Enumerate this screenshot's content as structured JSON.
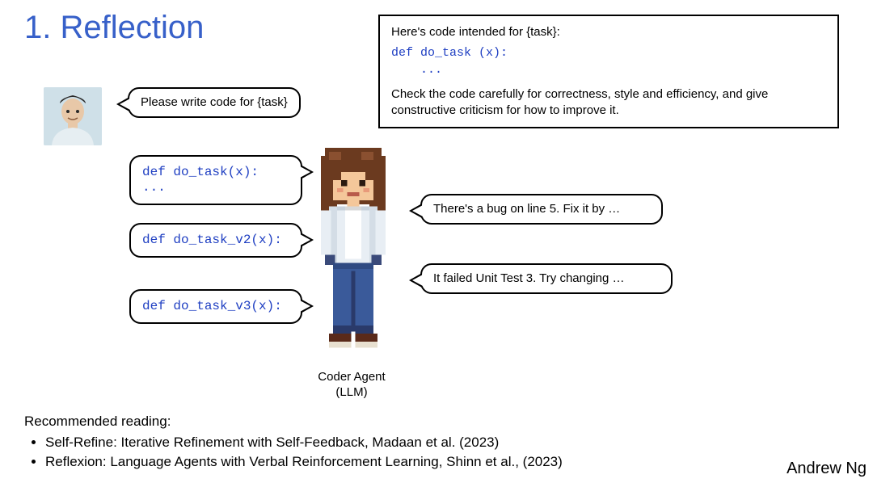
{
  "title": "1. Reflection",
  "top_box": {
    "line1": "Here's code intended for {task}:",
    "code": "def do_task (x):\n    ...",
    "line2": "Check the code carefully for correctness, style and efficiency, and give constructive criticism for how to improve it."
  },
  "user_bubble": "Please write code for {task}",
  "code_bubbles": [
    "def do_task(x): ...",
    "def do_task_v2(x):",
    "def do_task_v3(x):"
  ],
  "feedback_bubbles": [
    "There's a bug on line 5. Fix it by …",
    "It failed Unit Test 3. Try changing …"
  ],
  "agent_label_line1": "Coder Agent",
  "agent_label_line2": "(LLM)",
  "reading": {
    "heading": "Recommended reading:",
    "items": [
      "Self-Refine: Iterative Refinement with Self-Feedback, Madaan et al. (2023)",
      "Reflexion: Language Agents with Verbal Reinforcement Learning, Shinn et al., (2023)"
    ]
  },
  "author": "Andrew Ng"
}
